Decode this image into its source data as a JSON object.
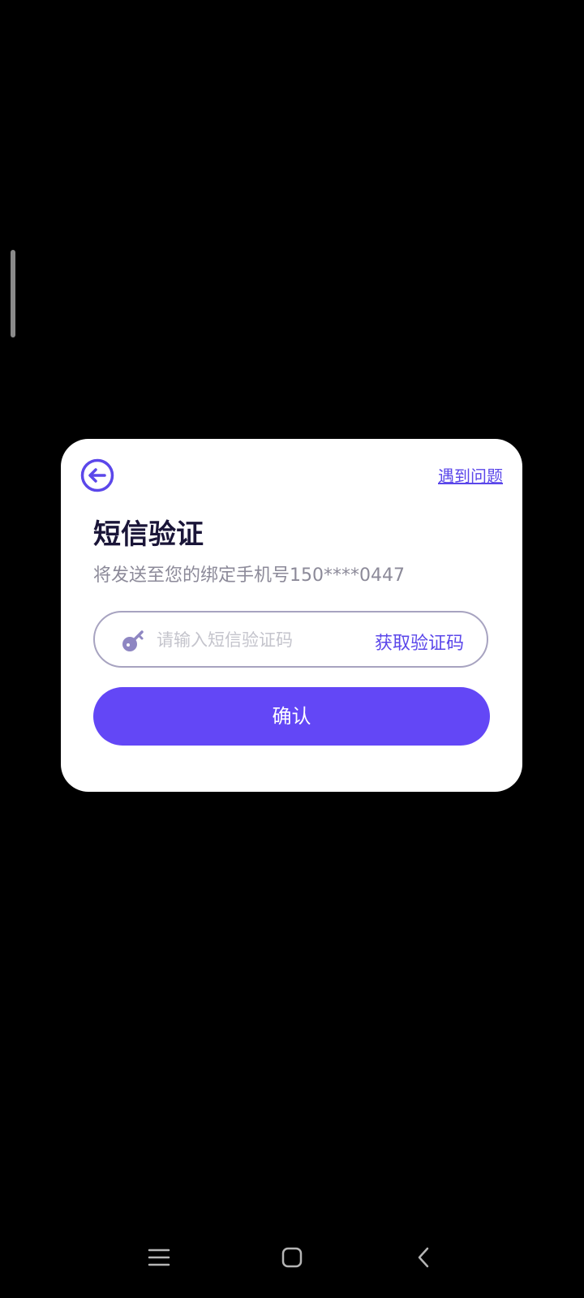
{
  "dialog": {
    "help_link": "遇到问题",
    "title": "短信验证",
    "subtitle": "将发送至您的绑定手机号150****0447",
    "code_input": {
      "placeholder": "请输入短信验证码",
      "value": ""
    },
    "get_code_label": "获取验证码",
    "confirm_label": "确认"
  },
  "icons": {
    "back": "arrow-left-circle-icon",
    "key": "key-icon",
    "nav_recents": "menu-lines-icon",
    "nav_home": "rounded-square-icon",
    "nav_back": "chevron-left-icon"
  },
  "colors": {
    "accent": "#5b47ea",
    "button": "#6347f6",
    "title": "#1a1538",
    "subtitle": "#8c8a99",
    "background": "#000000",
    "dialog": "#ffffff"
  }
}
